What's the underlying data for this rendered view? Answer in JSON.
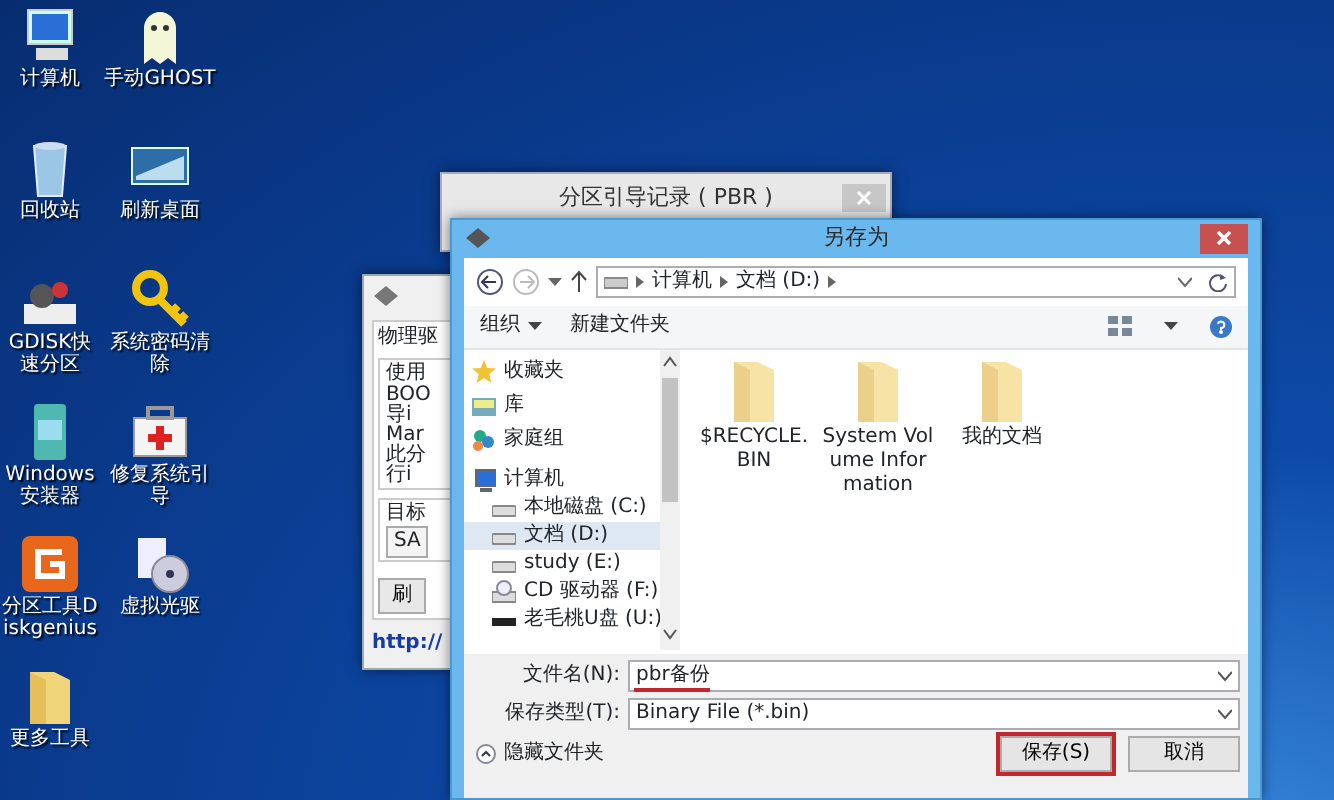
{
  "desktop_icons": [
    {
      "label": "计算机",
      "kind": "computer"
    },
    {
      "label": "手动GHOST",
      "kind": "ghost"
    },
    {
      "label": "回收站",
      "kind": "bin"
    },
    {
      "label": "刷新桌面",
      "kind": "screen"
    },
    {
      "label": "GDISK快速分区",
      "kind": "gears"
    },
    {
      "label": "系统密码清除",
      "kind": "key"
    },
    {
      "label": "Windows安装器",
      "kind": "installer"
    },
    {
      "label": "修复系统引导",
      "kind": "firstaid"
    },
    {
      "label": "分区工具Diskgenius",
      "kind": "diskgenius"
    },
    {
      "label": "虚拟光驱",
      "kind": "disc"
    },
    {
      "label": "更多工具",
      "kind": "folder"
    }
  ],
  "back_window": {
    "tab": "物理驱",
    "group": "使用",
    "lines": [
      "BOO",
      "导i",
      "Mar",
      "此分",
      "行i"
    ],
    "target_label": "目标",
    "target_value": "SA",
    "button": "刷",
    "link": "http://"
  },
  "pbr_window": {
    "title": "分区引导记录 ( PBR )"
  },
  "save_dialog": {
    "title": "另存为",
    "address": [
      "计算机",
      "文档 (D:)"
    ],
    "toolbar": {
      "organize": "组织",
      "new_folder": "新建文件夹"
    },
    "nav": [
      {
        "label": "收藏夹",
        "kind": "star",
        "selected": false
      },
      {
        "label": "库",
        "kind": "library",
        "selected": false
      },
      {
        "label": "家庭组",
        "kind": "homegroup",
        "selected": false
      },
      {
        "label": "计算机",
        "kind": "computer",
        "selected": false,
        "children": [
          {
            "label": "本地磁盘 (C:)",
            "kind": "drive",
            "selected": false
          },
          {
            "label": "文档 (D:)",
            "kind": "drive",
            "selected": true
          },
          {
            "label": "study (E:)",
            "kind": "drive",
            "selected": false
          },
          {
            "label": "CD 驱动器 (F:)",
            "kind": "cd",
            "selected": false
          },
          {
            "label": "老毛桃U盘 (U:)",
            "kind": "usb",
            "selected": false
          }
        ]
      }
    ],
    "files": [
      {
        "name": "$RECYCLE.BIN"
      },
      {
        "name": "System Volume Information"
      },
      {
        "name": "我的文档"
      }
    ],
    "filename": {
      "label": "文件名(N):",
      "value": "pbr备份",
      "underlined": true
    },
    "filetype": {
      "label": "保存类型(T):",
      "value": "Binary File (*.bin)"
    },
    "hide_folders": "隐藏文件夹",
    "buttons": [
      {
        "label": "保存(S)",
        "highlighted": true
      },
      {
        "label": "取消",
        "highlighted": false
      }
    ]
  }
}
